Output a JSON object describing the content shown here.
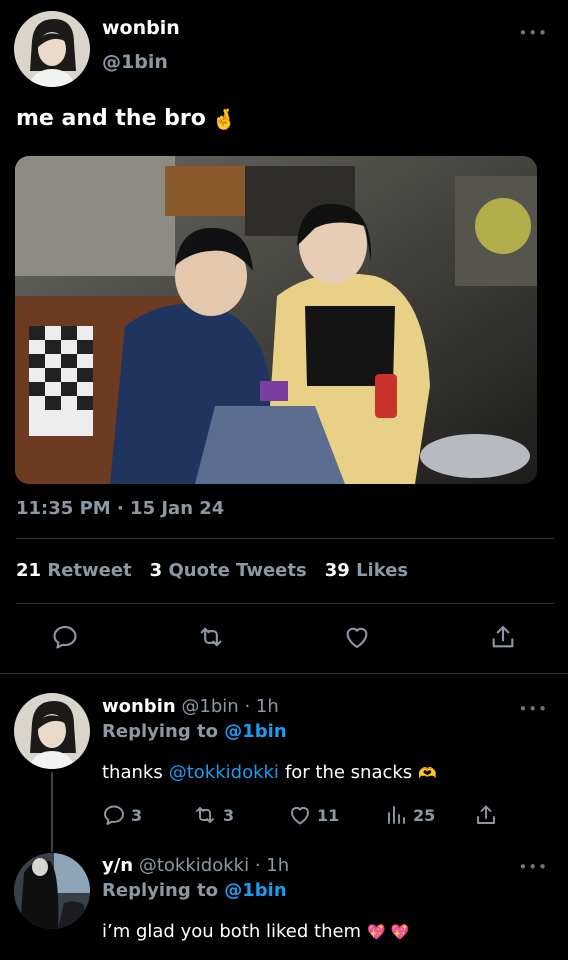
{
  "colors": {
    "background": "#000000",
    "primary_text": "#e7e9ea",
    "secondary_text": "#8b98a5",
    "link": "#1d9bf0",
    "divider": "#2f3336",
    "heart_emoji": "#ff4f9a"
  },
  "main_tweet": {
    "name": "wonbin",
    "handle": "@1bin",
    "text": "me and the bro",
    "text_emoji": "🤞",
    "timestamp": "11:35 PM · 15 Jan 24",
    "stats": {
      "retweets_count": "21",
      "retweets_label": "Retweet",
      "quotes_count": "3",
      "quotes_label": "Quote Tweets",
      "likes_count": "39",
      "likes_label": "Likes"
    },
    "actions": [
      {
        "name": "reply",
        "icon": "comment-icon"
      },
      {
        "name": "retweet",
        "icon": "retweet-icon"
      },
      {
        "name": "like",
        "icon": "heart-icon"
      },
      {
        "name": "share",
        "icon": "share-icon"
      }
    ]
  },
  "replies": [
    {
      "name": "wonbin",
      "handle": "@1bin",
      "sep": "·",
      "time": "1h",
      "replying_prefix": "Replying to",
      "replying_to": "@1bin",
      "text_mention": "@tokkidokki",
      "text_pre": "thanks",
      "text_post": "for the snacks",
      "emoji": "🫶",
      "counts": {
        "replies": "3",
        "retweets": "3",
        "likes": "11",
        "views": "25"
      }
    },
    {
      "name": "y/n",
      "handle": "@tokkidokki",
      "sep": "·",
      "time": "1h",
      "replying_prefix": "Replying to",
      "replying_to": "@1bin",
      "text": "i’m glad you both liked them",
      "emoji": "💖 💖"
    }
  ]
}
